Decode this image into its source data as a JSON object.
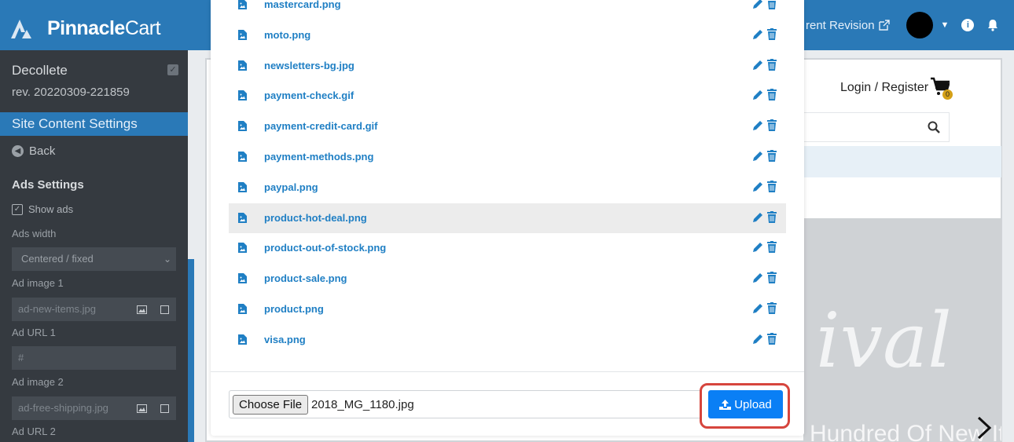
{
  "topbar": {
    "brand_bold": "Pinnacle",
    "brand_light": "Cart",
    "revision_link": "rent Revision",
    "icons": [
      "logo-mark-icon",
      "external-link-icon",
      "chevron-down-icon",
      "info-icon",
      "bell-icon"
    ]
  },
  "sidebar": {
    "store_name": "Decollete",
    "revision": "rev. 20220309-221859",
    "section_title": "Site Content Settings",
    "back_label": "Back",
    "ads_title": "Ads Settings",
    "show_ads_label": "Show ads",
    "ads_width_label": "Ads width",
    "ads_width_value": "Centered / fixed",
    "ad_image_1_label": "Ad image 1",
    "ad_image_1_placeholder": "ad-new-items.jpg",
    "ad_url_1_label": "Ad URL 1",
    "ad_url_1_placeholder": "#",
    "ad_image_2_label": "Ad image 2",
    "ad_image_2_placeholder": "ad-free-shipping.jpg",
    "ad_url_2_label": "Ad URL 2"
  },
  "preview": {
    "login_register": "Login / Register",
    "cart_count": "0",
    "hero_script": "ival",
    "hero_subtitle": "Hundred Of New Items"
  },
  "modal": {
    "files": [
      {
        "name": "mastercard.png"
      },
      {
        "name": "moto.png"
      },
      {
        "name": "newsletters-bg.jpg"
      },
      {
        "name": "payment-check.gif"
      },
      {
        "name": "payment-credit-card.gif"
      },
      {
        "name": "payment-methods.png"
      },
      {
        "name": "paypal.png"
      },
      {
        "name": "product-hot-deal.png",
        "highlighted": true
      },
      {
        "name": "product-out-of-stock.png"
      },
      {
        "name": "product-sale.png"
      },
      {
        "name": "product.png"
      },
      {
        "name": "visa.png"
      }
    ],
    "choose_file_label": "Choose File",
    "chosen_file": "2018_MG_1180.jpg",
    "upload_label": "Upload"
  },
  "colors": {
    "topbar": "#2a79b7",
    "sidebar": "#353a40",
    "link": "#1f7fc4",
    "upload_button": "#0a7ff5",
    "highlight_ring": "#d6453d"
  }
}
